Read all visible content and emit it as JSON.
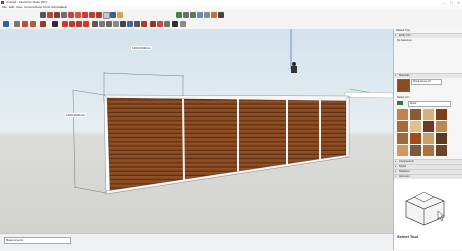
{
  "window": {
    "title": "Untitled - SketchUp Make 2017"
  },
  "menu": [
    "File",
    "Edit",
    "View",
    "Camera",
    "Draw",
    "Tools",
    "Window",
    "Help"
  ],
  "dimensions": {
    "top": "1200.0000mm",
    "left": "1200.0000mm"
  },
  "status": {
    "measurements_label": "Measurements"
  },
  "panel": {
    "default_tray": "Default Tray",
    "entity_info": "Entity Info",
    "no_selection": "No Selection",
    "materials": "Materials",
    "material_name": "Wood Veneer 01",
    "tab_select": "Select",
    "tab_edit": "Edit",
    "library": "Wood",
    "components": "Components",
    "styles": "Styles",
    "shadows": "Shadows",
    "instructor": "Instructor",
    "instructor_title": "Select Tool"
  },
  "colors": {
    "wood": "#8a4b22",
    "grain": "#5e2f12",
    "accent": "#d9342b"
  },
  "swatches": [
    "#c4824a",
    "#8b5a33",
    "#d9b07a",
    "#7a3f1d",
    "#a86a3a",
    "#e0c08c",
    "#6b3a1f",
    "#b98a55",
    "#9c6a3b",
    "#a34a1f",
    "#c8a06a",
    "#5a3b20",
    "#d2995e",
    "#7e5a3c",
    "#b07040",
    "#6e4426"
  ]
}
